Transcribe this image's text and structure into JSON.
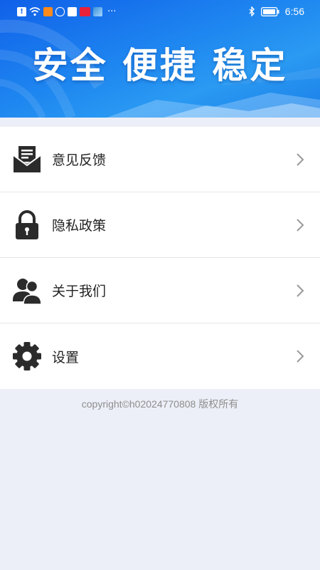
{
  "status_bar": {
    "time": "6:56",
    "left_icons": [
      "alert-icon",
      "wifi-icon",
      "app-icon-orange",
      "shield-icon",
      "music-icon",
      "app-icon-red",
      "app-icon-photo",
      "more-dots-icon"
    ],
    "more": "···"
  },
  "hero": {
    "title": "安全 便捷 稳定"
  },
  "menu": {
    "items": [
      {
        "label": "意见反馈",
        "icon": "feedback-mail-icon"
      },
      {
        "label": "隐私政策",
        "icon": "lock-icon"
      },
      {
        "label": "关于我们",
        "icon": "users-icon"
      },
      {
        "label": "设置",
        "icon": "gear-icon"
      }
    ]
  },
  "footer": {
    "copyright": "copyright©h02024770808 版权所有"
  },
  "colors": {
    "hero_blue": "#1E86F0",
    "background": "#ECEFF7",
    "icon_dark": "#2B2B2B",
    "arrow_gray": "#9A9A9A"
  }
}
